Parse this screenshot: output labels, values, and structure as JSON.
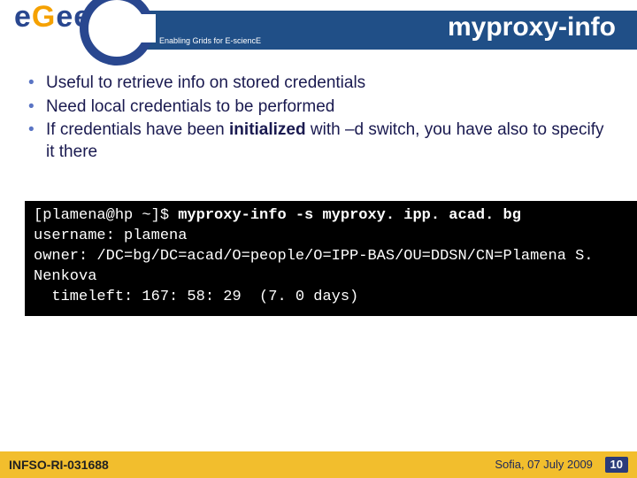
{
  "logo": {
    "letters": {
      "e1": "e",
      "g": "G",
      "e2": "e",
      "e3": "e"
    },
    "tagline": "Enabling Grids for E-sciencE"
  },
  "title": "myproxy-info",
  "bullets": [
    {
      "pre": "Useful to retrieve info on stored credentials"
    },
    {
      "pre": "Need local credentials to be performed"
    },
    {
      "pre": "If credentials have been ",
      "bold": "initialized",
      "post": " with –d switch, you have also to specify it there"
    }
  ],
  "terminal": {
    "prompt": "[plamena@hp ~]$ ",
    "cmd": "myproxy-info -s myproxy. ipp. acad. bg",
    "l2": "username: plamena",
    "l3": "owner: /DC=bg/DC=acad/O=people/O=IPP-BAS/OU=DDSN/CN=Plamena S. Nenkova",
    "l5": "  timeleft: 167: 58: 29  (7. 0 days)"
  },
  "footer": {
    "left": "INFSO-RI-031688",
    "right": "Sofia, 07 July 2009",
    "page": "10"
  }
}
